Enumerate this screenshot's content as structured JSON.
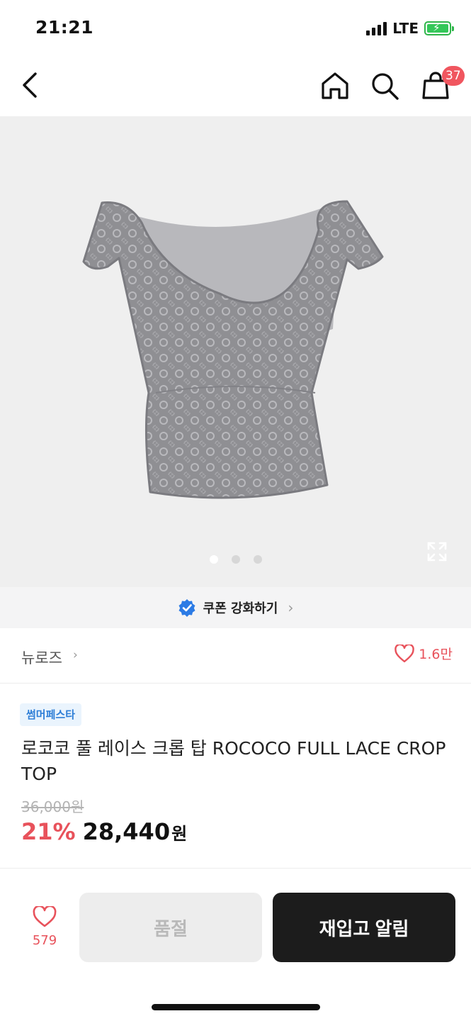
{
  "status_bar": {
    "time": "21:21",
    "network": "LTE"
  },
  "nav": {
    "icons": [
      "back-arrow-icon",
      "home-icon",
      "search-icon",
      "shopping-bag-icon"
    ],
    "cart_badge": "37"
  },
  "gallery": {
    "total_images": 3,
    "active_index": 0
  },
  "coupon": {
    "label": "쿠폰 강화하기"
  },
  "brand": {
    "name": "뉴로즈",
    "likes": "1.6만"
  },
  "product": {
    "tag": "썸머페스타",
    "title": "로코코 풀 레이스 크롭 탑 ROCOCO FULL LACE CROP TOP",
    "original_price": "36,000원",
    "discount": "21%",
    "price": "28,440",
    "currency": "원"
  },
  "bottom_bar": {
    "wish_count": "579",
    "soldout_label": "품절",
    "restock_label": "재입고 알림"
  },
  "colors": {
    "accent_red": "#e8525b",
    "badge_red": "#f0565f",
    "tag_blue": "#2f7fd7",
    "primary_dark": "#1c1c1c"
  }
}
